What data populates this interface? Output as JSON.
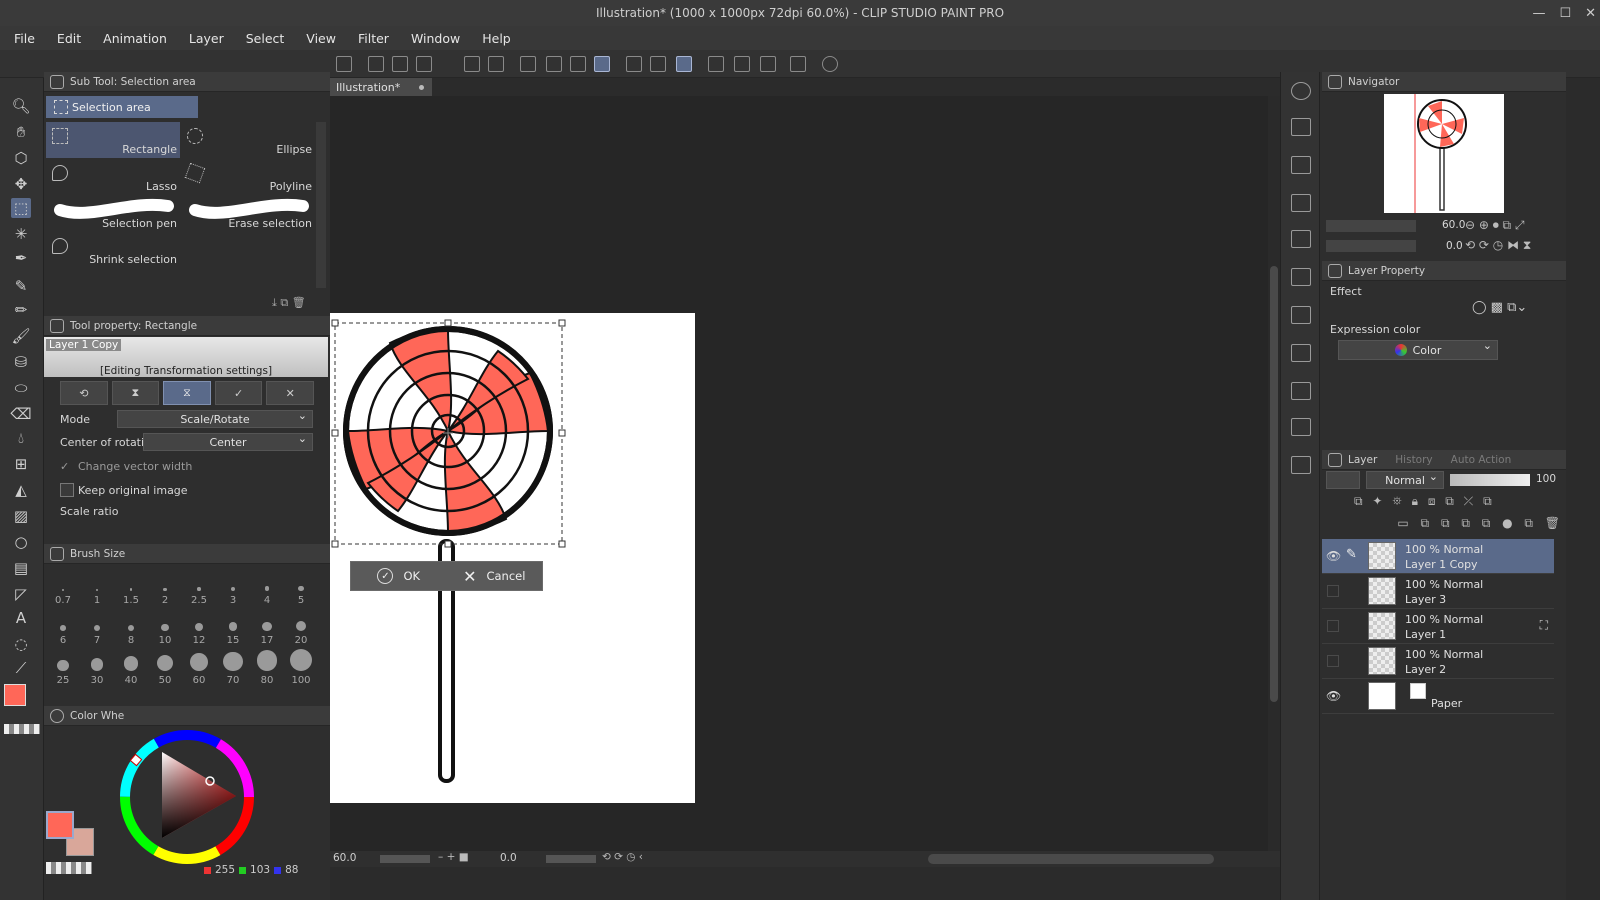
{
  "app": {
    "title": "Illustration* (1000 x 1000px 72dpi 60.0%)  - CLIP STUDIO PAINT PRO",
    "window_buttons": [
      "—",
      "☐",
      "✕"
    ]
  },
  "menu": [
    "File",
    "Edit",
    "Animation",
    "Layer",
    "Select",
    "View",
    "Filter",
    "Window",
    "Help"
  ],
  "subtool_panel": {
    "title": "Sub Tool: Selection area",
    "group_tab": "Selection area",
    "items": [
      "Rectangle",
      "Ellipse",
      "Lasso",
      "Polyline",
      "Selection pen",
      "Erase selection",
      "Shrink selection"
    ]
  },
  "tool_property": {
    "title": "Tool property: Rectangle",
    "layer_label": "Layer 1 Copy",
    "editing_label": "[Editing Transformation settings]",
    "mode_label": "Mode",
    "mode_value": "Scale/Rotate",
    "center_label": "Center of rotation",
    "center_value": "Center",
    "change_vector": "Change vector width",
    "keep_original": "Keep original image",
    "scale_ratio": "Scale ratio"
  },
  "brush_size": {
    "title": "Brush Size",
    "sizes": [
      "0.7",
      "1",
      "1.5",
      "2",
      "2.5",
      "3",
      "4",
      "5",
      "6",
      "7",
      "8",
      "10",
      "12",
      "15",
      "17",
      "20",
      "25",
      "30",
      "40",
      "50",
      "60",
      "70",
      "80",
      "100"
    ]
  },
  "color_wheel": {
    "title": "Color Whe",
    "r": "255",
    "g": "103",
    "b": "88",
    "main_color": "#ff6758",
    "sub_color": "#d9a79a"
  },
  "document": {
    "tab": "Illustration*",
    "ok": "OK",
    "cancel": "Cancel"
  },
  "status": {
    "zoom": "60.0",
    "angle": "0.0"
  },
  "navigator": {
    "title": "Navigator",
    "zoom": "60.0",
    "angle": "0.0"
  },
  "layer_property": {
    "title": "Layer Property",
    "effect": "Effect",
    "expression_color": "Expression color",
    "color_value": "Color"
  },
  "layer_panel": {
    "tabs": [
      "Layer",
      "History",
      "Auto Action"
    ],
    "blend_mode": "Normal",
    "opacity": "100",
    "layers": [
      {
        "mode": "100 % Normal",
        "name": "Layer 1 Copy"
      },
      {
        "mode": "100 % Normal",
        "name": "Layer 3"
      },
      {
        "mode": "100 % Normal",
        "name": "Layer 1"
      },
      {
        "mode": "100 % Normal",
        "name": "Layer 2"
      },
      {
        "mode": "",
        "name": "Paper"
      }
    ]
  }
}
